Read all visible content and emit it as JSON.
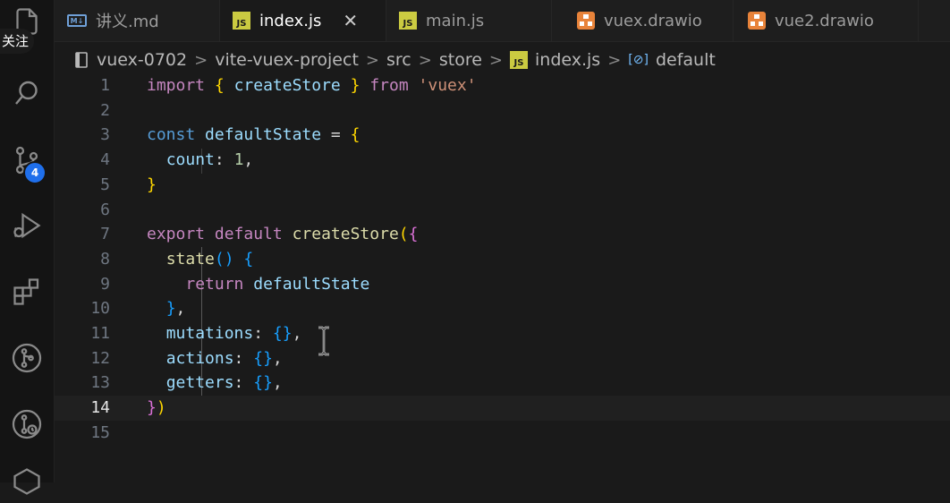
{
  "follow_label": "关注",
  "scm_badge": "4",
  "tabs": [
    {
      "label": "讲义.md",
      "icon": "markdown-icon",
      "active": false
    },
    {
      "label": "index.js",
      "icon": "js-icon",
      "active": true
    },
    {
      "label": "main.js",
      "icon": "js-icon",
      "active": false
    },
    {
      "label": "vuex.drawio",
      "icon": "drawio-icon",
      "active": false
    },
    {
      "label": "vue2.drawio",
      "icon": "drawio-icon",
      "active": false
    }
  ],
  "close_glyph": "✕",
  "breadcrumb": {
    "items": [
      "vuex-0702",
      "vite-vuex-project",
      "src",
      "store",
      "index.js",
      "default"
    ],
    "separator": ">",
    "symbol_glyph": "[⊘]"
  },
  "editor": {
    "current_line": 14,
    "lines": [
      {
        "n": "1",
        "tokens": [
          [
            "kw",
            "import"
          ],
          [
            "pl",
            " "
          ],
          [
            "br1",
            "{"
          ],
          [
            "pl",
            " "
          ],
          [
            "id",
            "createStore"
          ],
          [
            "pl",
            " "
          ],
          [
            "br1",
            "}"
          ],
          [
            "pl",
            " "
          ],
          [
            "kw",
            "from"
          ],
          [
            "pl",
            " "
          ],
          [
            "str",
            "'vuex'"
          ]
        ]
      },
      {
        "n": "2",
        "tokens": []
      },
      {
        "n": "3",
        "tokens": [
          [
            "kw2",
            "const"
          ],
          [
            "pl",
            " "
          ],
          [
            "id",
            "defaultState"
          ],
          [
            "pl",
            " = "
          ],
          [
            "br1",
            "{"
          ]
        ]
      },
      {
        "n": "4",
        "tokens": [
          [
            "pl",
            "  "
          ],
          [
            "id",
            "count"
          ],
          [
            "pl",
            ": "
          ],
          [
            "num",
            "1"
          ],
          [
            "pl",
            ","
          ]
        ]
      },
      {
        "n": "5",
        "tokens": [
          [
            "br1",
            "}"
          ]
        ]
      },
      {
        "n": "6",
        "tokens": []
      },
      {
        "n": "7",
        "tokens": [
          [
            "kw",
            "export"
          ],
          [
            "pl",
            " "
          ],
          [
            "kw",
            "default"
          ],
          [
            "pl",
            " "
          ],
          [
            "fn",
            "createStore"
          ],
          [
            "br1",
            "("
          ],
          [
            "br2",
            "{"
          ]
        ]
      },
      {
        "n": "8",
        "tokens": [
          [
            "pl",
            "  "
          ],
          [
            "fn",
            "state"
          ],
          [
            "br3",
            "()"
          ],
          [
            "pl",
            " "
          ],
          [
            "br3",
            "{"
          ]
        ]
      },
      {
        "n": "9",
        "tokens": [
          [
            "pl",
            "    "
          ],
          [
            "kw",
            "return"
          ],
          [
            "pl",
            " "
          ],
          [
            "id",
            "defaultState"
          ]
        ]
      },
      {
        "n": "10",
        "tokens": [
          [
            "pl",
            "  "
          ],
          [
            "br3",
            "}"
          ],
          [
            "pl",
            ","
          ]
        ]
      },
      {
        "n": "11",
        "tokens": [
          [
            "pl",
            "  "
          ],
          [
            "id",
            "mutations"
          ],
          [
            "pl",
            ": "
          ],
          [
            "br3",
            "{}"
          ],
          [
            "pl",
            ","
          ]
        ]
      },
      {
        "n": "12",
        "tokens": [
          [
            "pl",
            "  "
          ],
          [
            "id",
            "actions"
          ],
          [
            "pl",
            ": "
          ],
          [
            "br3",
            "{}"
          ],
          [
            "pl",
            ","
          ]
        ]
      },
      {
        "n": "13",
        "tokens": [
          [
            "pl",
            "  "
          ],
          [
            "id",
            "getters"
          ],
          [
            "pl",
            ": "
          ],
          [
            "br3",
            "{}"
          ],
          [
            "pl",
            ","
          ]
        ]
      },
      {
        "n": "14",
        "tokens": [
          [
            "br2",
            "}"
          ],
          [
            "br1",
            ")"
          ]
        ]
      },
      {
        "n": "15",
        "tokens": []
      }
    ]
  },
  "colors": {
    "js_icon": "#cbcb41",
    "drawio_icon": "#e8833a",
    "badge": "#1f6feb"
  }
}
